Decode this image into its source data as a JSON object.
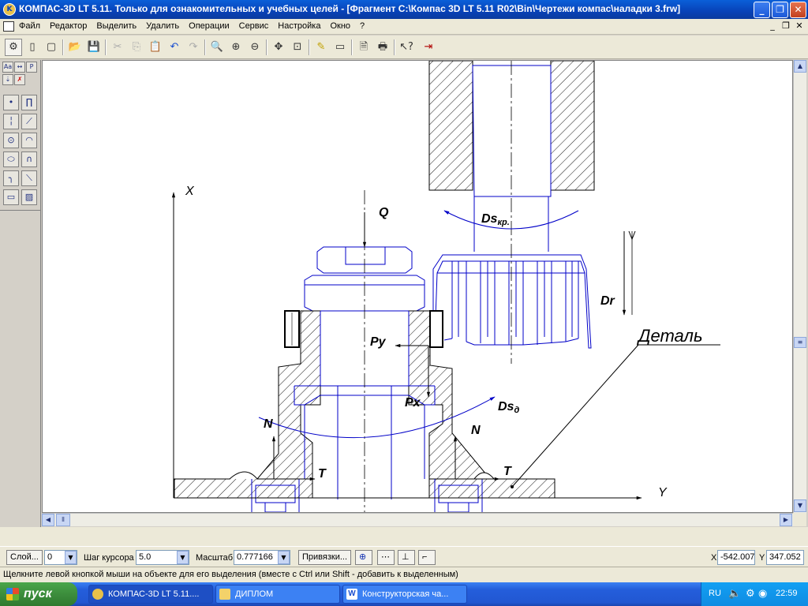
{
  "window": {
    "title": "КОМПАС-3D LT 5.11. Только для ознакомительных и учебных целей - [Фрагмент C:\\Компас 3D LT 5.11 R02\\Bin\\Чертежи компас\\наладки 3.frw]",
    "app_icon_letter": "K"
  },
  "menu": {
    "items": [
      "Файл",
      "Редактор",
      "Выделить",
      "Удалить",
      "Операции",
      "Сервис",
      "Настройка",
      "Окно",
      "?"
    ]
  },
  "drawing": {
    "labels": {
      "axis_x": "X",
      "axis_y": "Y",
      "q": "Q",
      "ds_kr": "Ds",
      "ds_kr_sub": "кр.",
      "dr": "Dr",
      "detail": "Деталь",
      "py": "Py",
      "px": "Px",
      "ds_d": "Ds",
      "ds_d_sub": "д",
      "n_left": "N",
      "n_right": "N",
      "t_left": "T",
      "t_right": "T"
    }
  },
  "status_bar": {
    "layer_button": "Слой...",
    "layer_value": "0",
    "cursor_step_label": "Шаг курсора",
    "cursor_step_value": "5.0",
    "scale_label": "Масштаб",
    "scale_value": "0.777166",
    "snaps_button": "Привязки...",
    "coord_x_label": "X",
    "coord_x_value": "-542.007",
    "coord_y_label": "Y",
    "coord_y_value": "347.052",
    "message": "Щелкните левой кнопкой мыши на объекте для его выделения (вместе с Ctrl или Shift - добавить к выделенным)"
  },
  "taskbar": {
    "start_label": "пуск",
    "tasks": [
      "КОМПАС-3D LT 5.11....",
      "ДИПЛОМ",
      "Конструкторская ча..."
    ],
    "language": "RU",
    "clock": "22:59"
  },
  "colors": {
    "titlebar": "#0842b8",
    "drawing_blue": "#0000c8",
    "drawing_black": "#000000"
  }
}
